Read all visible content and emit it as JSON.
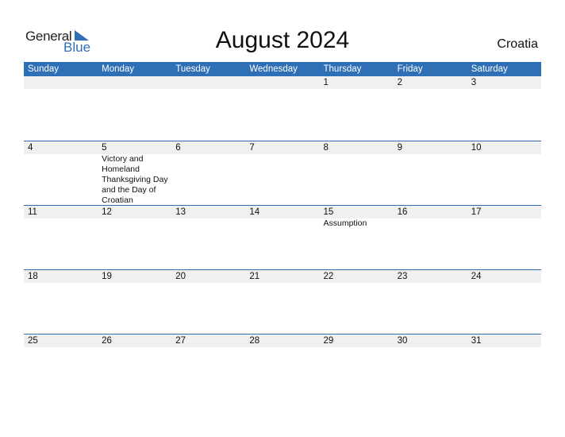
{
  "logo": {
    "line1": "General",
    "line2": "Blue"
  },
  "title": "August 2024",
  "country": "Croatia",
  "colors": {
    "accent": "#2e6fb5",
    "band": "#f0f0f0"
  },
  "weekdays": [
    "Sunday",
    "Monday",
    "Tuesday",
    "Wednesday",
    "Thursday",
    "Friday",
    "Saturday"
  ],
  "weeks": [
    [
      {
        "d": ""
      },
      {
        "d": ""
      },
      {
        "d": ""
      },
      {
        "d": ""
      },
      {
        "d": "1"
      },
      {
        "d": "2"
      },
      {
        "d": "3"
      }
    ],
    [
      {
        "d": "4"
      },
      {
        "d": "5",
        "ev": "Victory and Homeland Thanksgiving Day and the Day of Croatian defenders"
      },
      {
        "d": "6"
      },
      {
        "d": "7"
      },
      {
        "d": "8"
      },
      {
        "d": "9"
      },
      {
        "d": "10"
      }
    ],
    [
      {
        "d": "11"
      },
      {
        "d": "12"
      },
      {
        "d": "13"
      },
      {
        "d": "14"
      },
      {
        "d": "15",
        "ev": "Assumption"
      },
      {
        "d": "16"
      },
      {
        "d": "17"
      }
    ],
    [
      {
        "d": "18"
      },
      {
        "d": "19"
      },
      {
        "d": "20"
      },
      {
        "d": "21"
      },
      {
        "d": "22"
      },
      {
        "d": "23"
      },
      {
        "d": "24"
      }
    ],
    [
      {
        "d": "25"
      },
      {
        "d": "26"
      },
      {
        "d": "27"
      },
      {
        "d": "28"
      },
      {
        "d": "29"
      },
      {
        "d": "30"
      },
      {
        "d": "31"
      }
    ]
  ]
}
